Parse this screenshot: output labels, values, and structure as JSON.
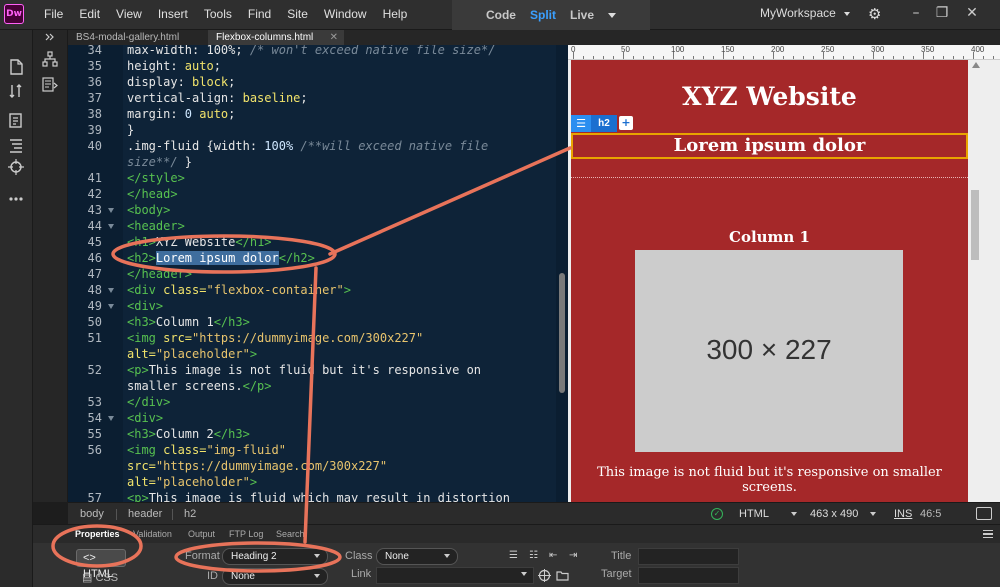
{
  "app": {
    "logo": "Dw"
  },
  "menu": [
    "File",
    "Edit",
    "View",
    "Insert",
    "Tools",
    "Find",
    "Site",
    "Window",
    "Help"
  ],
  "view_switcher": {
    "tabs": [
      "Code",
      "Split",
      "Live"
    ],
    "active": "Split"
  },
  "workspace": {
    "label": "MyWorkspace"
  },
  "doc_tabs": [
    {
      "label": "BS4-modal-gallery.html",
      "active": false
    },
    {
      "label": "Flexbox-columns.html",
      "active": true
    }
  ],
  "code": {
    "lines": [
      {
        "n": "34",
        "fold": false,
        "parts": [
          [
            "c-plain",
            "max-width: 100%; "
          ],
          [
            "c-cmt",
            "/* won't exceed native file size*/"
          ]
        ]
      },
      {
        "n": "35",
        "fold": false,
        "parts": [
          [
            "c-prop",
            "height: "
          ],
          [
            "c-val",
            "auto"
          ],
          [
            "c-plain",
            ";"
          ]
        ]
      },
      {
        "n": "36",
        "fold": false,
        "parts": [
          [
            "c-prop",
            "display: "
          ],
          [
            "c-val",
            "block"
          ],
          [
            "c-plain",
            ";"
          ]
        ]
      },
      {
        "n": "37",
        "fold": false,
        "parts": [
          [
            "c-prop",
            "vertical-align: "
          ],
          [
            "c-val",
            "baseline"
          ],
          [
            "c-plain",
            ";"
          ]
        ]
      },
      {
        "n": "38",
        "fold": false,
        "parts": [
          [
            "c-prop",
            "margin: "
          ],
          [
            "c-num",
            "0"
          ],
          [
            "c-val",
            " auto"
          ],
          [
            "c-plain",
            ";"
          ]
        ]
      },
      {
        "n": "39",
        "fold": false,
        "parts": [
          [
            "c-plain",
            "}"
          ]
        ]
      },
      {
        "n": "40",
        "fold": false,
        "parts": [
          [
            "c-plain",
            ".img-fluid {width: "
          ],
          [
            "c-num",
            "100%"
          ],
          [
            "c-cmt",
            " /**will exceed native file"
          ]
        ]
      },
      {
        "n": "",
        "fold": false,
        "parts": [
          [
            "c-cmt",
            "size**/"
          ],
          [
            "c-plain",
            " }"
          ]
        ]
      },
      {
        "n": "41",
        "fold": false,
        "parts": [
          [
            "c-tag",
            "</style>"
          ]
        ]
      },
      {
        "n": "42",
        "fold": false,
        "parts": [
          [
            "c-tag",
            "</head>"
          ]
        ]
      },
      {
        "n": "43",
        "fold": true,
        "parts": [
          [
            "c-tag",
            "<body>"
          ]
        ]
      },
      {
        "n": "44",
        "fold": true,
        "parts": [
          [
            "c-tag",
            "<header>"
          ]
        ]
      },
      {
        "n": "45",
        "fold": false,
        "parts": [
          [
            "c-tag",
            "<h1>"
          ],
          [
            "c-plain",
            "XYZ Website"
          ],
          [
            "c-tag",
            "</h1>"
          ]
        ]
      },
      {
        "n": "46",
        "fold": false,
        "parts": [
          [
            "c-tag",
            "<h2>"
          ],
          [
            "c-sel",
            "Lorem ipsum dolor"
          ],
          [
            "c-tag",
            "</h2>"
          ]
        ]
      },
      {
        "n": "47",
        "fold": false,
        "parts": [
          [
            "c-tag",
            "</header>"
          ]
        ]
      },
      {
        "n": "48",
        "fold": true,
        "parts": [
          [
            "c-tag",
            "<div "
          ],
          [
            "c-val",
            "class="
          ],
          [
            "c-str",
            "\"flexbox-container\""
          ],
          [
            "c-tag",
            ">"
          ]
        ]
      },
      {
        "n": "49",
        "fold": true,
        "parts": [
          [
            "c-tag",
            "<div>"
          ]
        ]
      },
      {
        "n": "50",
        "fold": false,
        "parts": [
          [
            "c-tag",
            "<h3>"
          ],
          [
            "c-plain",
            "Column 1"
          ],
          [
            "c-tag",
            "</h3>"
          ]
        ]
      },
      {
        "n": "51",
        "fold": false,
        "parts": [
          [
            "c-tag",
            "<img "
          ],
          [
            "c-val",
            "src="
          ],
          [
            "c-str",
            "\"https://dummyimage.com/300x227\""
          ]
        ]
      },
      {
        "n": "",
        "fold": false,
        "parts": [
          [
            "c-val",
            "alt="
          ],
          [
            "c-str",
            "\"placeholder\""
          ],
          [
            "c-tag",
            ">"
          ]
        ]
      },
      {
        "n": "52",
        "fold": false,
        "parts": [
          [
            "c-tag",
            "<p>"
          ],
          [
            "c-plain",
            "This image is not fluid but it's responsive on"
          ]
        ]
      },
      {
        "n": "",
        "fold": false,
        "parts": [
          [
            "c-plain",
            "smaller screens."
          ],
          [
            "c-tag",
            "</p>"
          ]
        ]
      },
      {
        "n": "53",
        "fold": false,
        "parts": [
          [
            "c-tag",
            "</div>"
          ]
        ]
      },
      {
        "n": "54",
        "fold": true,
        "parts": [
          [
            "c-tag",
            "<div>"
          ]
        ]
      },
      {
        "n": "55",
        "fold": false,
        "parts": [
          [
            "c-tag",
            "<h3>"
          ],
          [
            "c-plain",
            "Column 2"
          ],
          [
            "c-tag",
            "</h3>"
          ]
        ]
      },
      {
        "n": "56",
        "fold": false,
        "parts": [
          [
            "c-tag",
            "<img "
          ],
          [
            "c-val",
            "class="
          ],
          [
            "c-str",
            "\"img-fluid\""
          ]
        ]
      },
      {
        "n": "",
        "fold": false,
        "parts": [
          [
            "c-val",
            "src="
          ],
          [
            "c-str",
            "\"https://dummyimage.com/300x227\""
          ]
        ]
      },
      {
        "n": "",
        "fold": false,
        "parts": [
          [
            "c-val",
            "alt="
          ],
          [
            "c-str",
            "\"placeholder\""
          ],
          [
            "c-tag",
            ">"
          ]
        ]
      },
      {
        "n": "57",
        "fold": false,
        "parts": [
          [
            "c-tag",
            "<p>"
          ],
          [
            "c-plain",
            "This image is fluid which may result in distortion"
          ]
        ]
      }
    ]
  },
  "ruler": [
    "0",
    "50",
    "100",
    "150",
    "200",
    "250",
    "300",
    "350",
    "400"
  ],
  "live": {
    "h1": "XYZ Website",
    "h2": "Lorem ipsum dolor",
    "badge_tag": "h2",
    "badge_add": "+",
    "col1_heading": "Column 1",
    "placeholder": "300 × 227",
    "col1_text": "This image is not fluid but it's responsive on smaller screens."
  },
  "tag_bar": {
    "crumbs": [
      "body",
      "header",
      "h2"
    ],
    "doc_type": "HTML",
    "window_size": "463 x 490",
    "ins": "INS",
    "cursor": "46:5"
  },
  "properties": {
    "tabs": [
      "Properties",
      "Validation",
      "Output",
      "FTP Log",
      "Search"
    ],
    "active_tab": "Properties",
    "html_button": "HTML",
    "css_button": "CSS",
    "format_label": "Format",
    "format_value": "Heading 2",
    "id_label": "ID",
    "id_value": "None",
    "class_label": "Class",
    "class_value": "None",
    "link_label": "Link",
    "title_label": "Title",
    "target_label": "Target"
  },
  "colors": {
    "accent": "#3ba0ff",
    "page_bg": "#a52829",
    "selection_outline": "#e8a400",
    "annotation": "#e8735a"
  },
  "icons": {
    "left_toolbar": [
      "files-icon",
      "git-icon",
      "snippets-icon",
      "dom-icon",
      "target-icon",
      "more-icon"
    ]
  }
}
